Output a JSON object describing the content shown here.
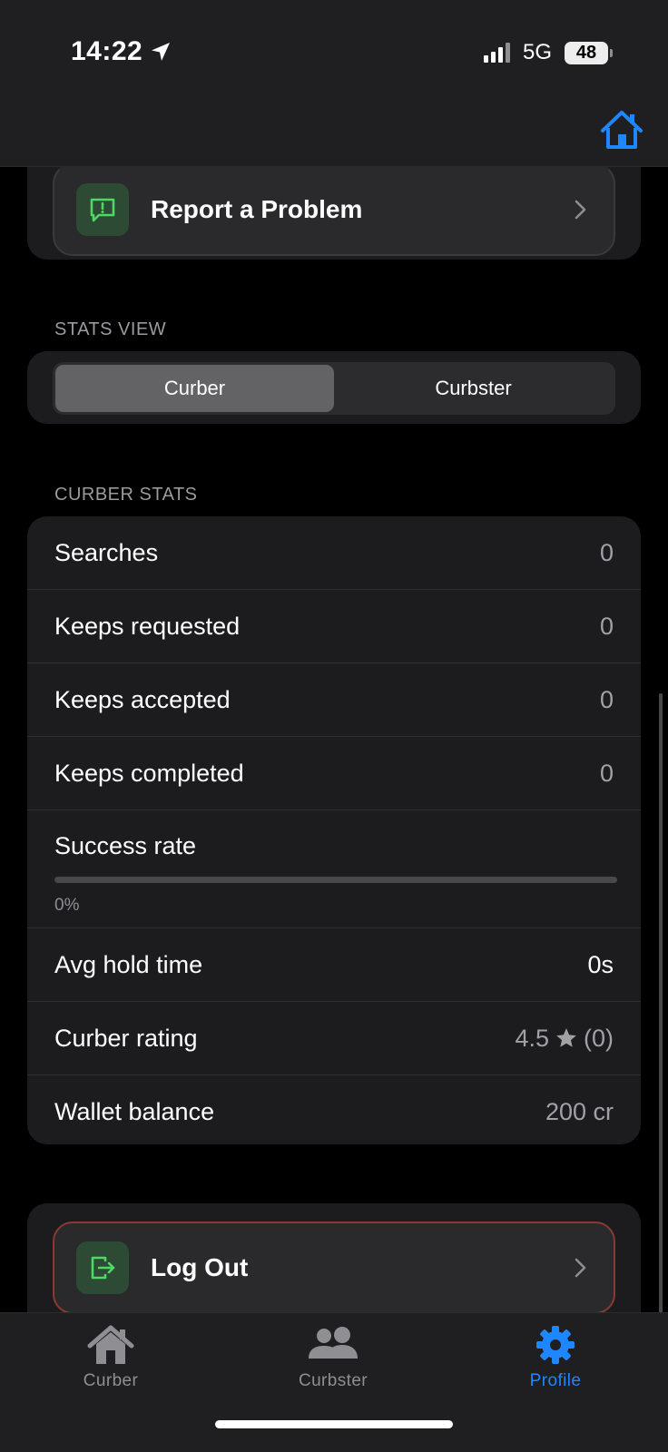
{
  "status_bar": {
    "time": "14:22",
    "network": "5G",
    "battery": "48"
  },
  "report": {
    "label": "Report a Problem"
  },
  "stats_view": {
    "header": "STATS VIEW",
    "options": [
      "Curber",
      "Curbster"
    ],
    "selected": "Curber"
  },
  "curber_stats": {
    "header": "CURBER STATS",
    "searches": {
      "label": "Searches",
      "value": "0"
    },
    "keeps_requested": {
      "label": "Keeps requested",
      "value": "0"
    },
    "keeps_accepted": {
      "label": "Keeps accepted",
      "value": "0"
    },
    "keeps_completed": {
      "label": "Keeps completed",
      "value": "0"
    },
    "success_rate": {
      "label": "Success rate",
      "value": "0%",
      "progress": 0
    },
    "avg_hold_time": {
      "label": "Avg hold time",
      "value": "0s"
    },
    "curber_rating": {
      "label": "Curber rating",
      "rating": "4.5",
      "count": "(0)"
    },
    "wallet_balance": {
      "label": "Wallet balance",
      "value": "200 cr"
    }
  },
  "logout": {
    "label": "Log Out"
  },
  "tabs": [
    {
      "label": "Curber",
      "icon": "house-icon",
      "active": false
    },
    {
      "label": "Curbster",
      "icon": "people-icon",
      "active": false
    },
    {
      "label": "Profile",
      "icon": "gear-icon",
      "active": true
    }
  ],
  "colors": {
    "accent_blue": "#1e86ff",
    "tile_green": "#2d4a34",
    "icon_green": "#4cd964",
    "logout_border": "#8a3a32"
  }
}
